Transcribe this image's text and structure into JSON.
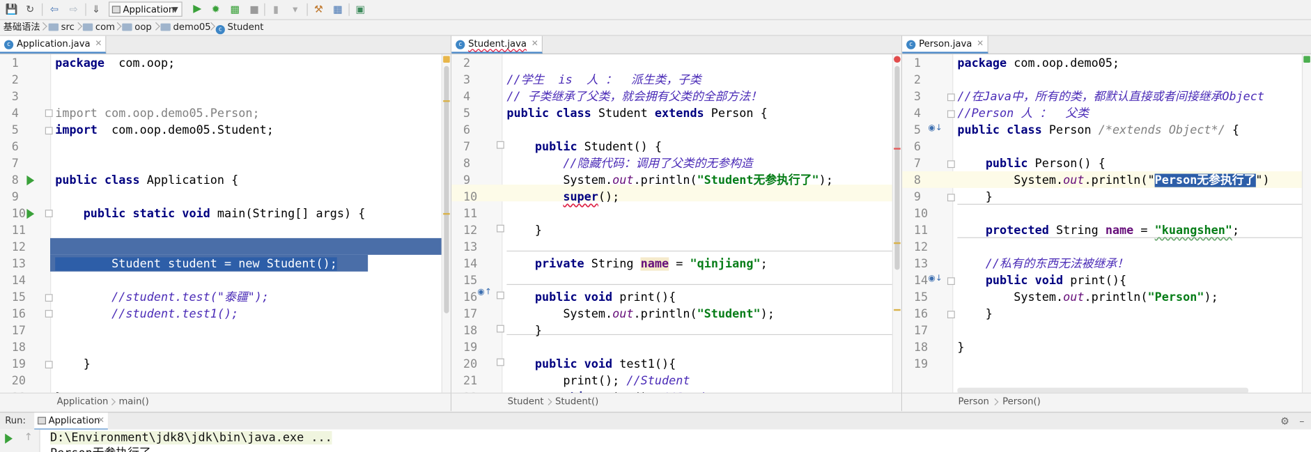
{
  "toolbar": {
    "run_config": "Application",
    "icons": [
      "save-icon",
      "sync-icon",
      "back-icon",
      "forward-icon",
      "build-icon",
      "run-icon",
      "debug-icon",
      "coverage-icon",
      "stop-icon",
      "profile-icon",
      "tools-icon",
      "structure-icon",
      "project-structure-icon"
    ],
    "colors": {
      "run": "#3aa13a",
      "accent": "#4a88c7"
    }
  },
  "breadcrumb": [
    "基础语法",
    "src",
    "com",
    "oop",
    "demo05",
    "Student"
  ],
  "panes": [
    {
      "tab": "Application.java",
      "first_line": 1,
      "breadcrumb": [
        "Application",
        "main()"
      ],
      "lines": [
        [
          [
            "kw",
            "package"
          ],
          [
            "",
            "  com.oop;"
          ]
        ],
        [],
        [],
        [
          [
            "gray",
            "import com.oop.demo05.Person;"
          ]
        ],
        [
          [
            "kw",
            "import"
          ],
          [
            "",
            "  com.oop.demo05.Student;"
          ]
        ],
        [],
        [],
        [
          [
            "kw",
            "public class"
          ],
          [
            "",
            " Application {"
          ]
        ],
        [],
        [
          [
            "",
            "    "
          ],
          [
            "kw",
            "public static void"
          ],
          [
            "",
            " main(String[] args) {"
          ]
        ],
        [],
        [],
        [
          [
            "sel",
            "        Student student = new Student();"
          ]
        ],
        [],
        [
          [
            "cmt",
            "        //student.test(\"泰疆\");"
          ]
        ],
        [
          [
            "cmt",
            "        //student.test1();"
          ]
        ],
        [],
        [],
        [
          [
            "",
            "    }"
          ]
        ],
        [],
        [
          [
            "",
            "}"
          ]
        ]
      ]
    },
    {
      "tab": "Student.java",
      "first_line": 2,
      "breadcrumb": [
        "Student",
        "Student()"
      ],
      "lines": [
        [],
        [
          [
            "cmt",
            "//学生  is  人 ：  派生类，子类"
          ]
        ],
        [
          [
            "cmt",
            "// 子类继承了父类，就会拥有父类的全部方法！"
          ]
        ],
        [
          [
            "kw",
            "public class"
          ],
          [
            "",
            " Student "
          ],
          [
            "kw",
            "extends"
          ],
          [
            "",
            " Person {"
          ]
        ],
        [],
        [
          [
            "",
            "    "
          ],
          [
            "kw",
            "public"
          ],
          [
            "",
            " Student() {"
          ]
        ],
        [
          [
            "cmt",
            "        //隐藏代码：调用了父类的无参构造"
          ]
        ],
        [
          [
            "",
            "        System."
          ],
          [
            "stat",
            "out"
          ],
          [
            "",
            ".println("
          ],
          [
            "str",
            "\"Student无参执行了\""
          ],
          [
            "",
            ");"
          ]
        ],
        [
          [
            "",
            "        "
          ],
          [
            "kwwavy",
            "super"
          ],
          [
            "",
            "();"
          ]
        ],
        [],
        [
          [
            "",
            "    }"
          ]
        ],
        [],
        [
          [
            "",
            "    "
          ],
          [
            "kw",
            "private"
          ],
          [
            "",
            " String "
          ],
          [
            "fldhl",
            "name"
          ],
          [
            "",
            " = "
          ],
          [
            "str",
            "\"qinjiang\""
          ],
          [
            "",
            ";"
          ]
        ],
        [],
        [
          [
            "",
            "    "
          ],
          [
            "kw",
            "public void"
          ],
          [
            "",
            " print(){"
          ]
        ],
        [
          [
            "",
            "        System."
          ],
          [
            "stat",
            "out"
          ],
          [
            "",
            ".println("
          ],
          [
            "str",
            "\"Student\""
          ],
          [
            "",
            ");"
          ]
        ],
        [
          [
            "",
            "    }"
          ]
        ],
        [],
        [
          [
            "",
            "    "
          ],
          [
            "kw",
            "public void"
          ],
          [
            "",
            " test1(){"
          ]
        ],
        [
          [
            "",
            "        print(); "
          ],
          [
            "cmt",
            "//Student"
          ]
        ],
        [
          [
            "",
            "        "
          ],
          [
            "kw",
            "this"
          ],
          [
            "",
            ".print(); "
          ],
          [
            "cmt",
            "//Student"
          ]
        ]
      ]
    },
    {
      "tab": "Person.java",
      "first_line": 1,
      "breadcrumb": [
        "Person",
        "Person()"
      ],
      "lines": [
        [
          [
            "kw",
            "package"
          ],
          [
            "",
            " com.oop.demo05;"
          ]
        ],
        [],
        [
          [
            "cmt",
            "//在Java中，所有的类，都默认直接或者间接继承Object"
          ]
        ],
        [
          [
            "cmt",
            "//Person 人 ：  父类"
          ]
        ],
        [
          [
            "kw",
            "public class"
          ],
          [
            "",
            " Person "
          ],
          [
            "mlc",
            "/*extends Object*/"
          ],
          [
            "",
            " {"
          ]
        ],
        [],
        [
          [
            "",
            "    "
          ],
          [
            "kw",
            "public"
          ],
          [
            "",
            " Person() {"
          ]
        ],
        [
          [
            "",
            "        System."
          ],
          [
            "stat",
            "out"
          ],
          [
            "",
            ".println(\""
          ],
          [
            "strsel",
            "Person无参执行了"
          ],
          [
            "",
            "\")"
          ]
        ],
        [
          [
            "",
            "    }"
          ]
        ],
        [],
        [
          [
            "",
            "    "
          ],
          [
            "kw",
            "protected"
          ],
          [
            "",
            " String "
          ],
          [
            "fld",
            "name"
          ],
          [
            "",
            " = "
          ],
          [
            "strwavy",
            "\"kuangshen\""
          ],
          [
            "",
            ";"
          ]
        ],
        [],
        [
          [
            "cmt",
            "    //私有的东西无法被继承！"
          ]
        ],
        [
          [
            "",
            "    "
          ],
          [
            "kw",
            "public void"
          ],
          [
            "",
            " print(){"
          ]
        ],
        [
          [
            "",
            "        System."
          ],
          [
            "stat",
            "out"
          ],
          [
            "",
            ".println("
          ],
          [
            "str",
            "\"Person\""
          ],
          [
            "",
            ");"
          ]
        ],
        [
          [
            "",
            "    }"
          ]
        ],
        [],
        [
          [
            "",
            "}"
          ]
        ],
        []
      ]
    }
  ],
  "run": {
    "label": "Run:",
    "tab": "Application",
    "console": [
      "D:\\Environment\\jdk8\\jdk\\bin\\java.exe ...",
      "Person无参执行了"
    ]
  }
}
